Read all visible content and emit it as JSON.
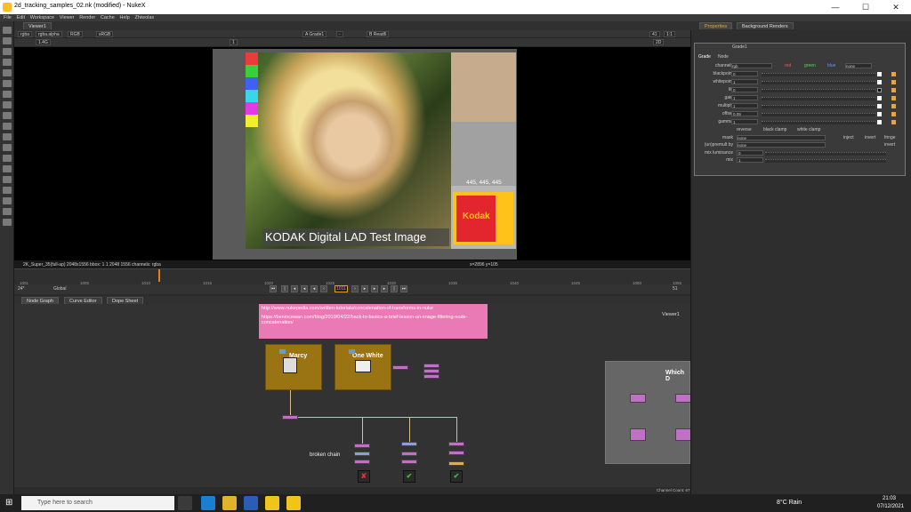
{
  "window": {
    "title": "2d_tracking_samples_02.nk (modified) - NukeX",
    "minimize": "—",
    "maximize": "☐",
    "close": "✕"
  },
  "menu": [
    "File",
    "Edit",
    "Workspace",
    "Viewer",
    "Render",
    "Cache",
    "Help",
    "Zhiwolas"
  ],
  "viewer": {
    "tab": "Viewer1",
    "controls1": [
      "rgba",
      "rgba.alpha",
      "RGB",
      "sRGB",
      "A  Grade1",
      "-",
      "B  Read6",
      "41",
      "1:1",
      "2D"
    ],
    "controls2": [
      "1.4G",
      "f/8",
      "1",
      "Y",
      "1"
    ],
    "image_value": "445, 445, 445",
    "kodak_logo": "Kodak",
    "caption": "KODAK Digital LAD Test Image",
    "info_left": "2K_Super_35(full-ap) 2048x1556  bbox: 1 1 2048 1556 channels: rgba",
    "info_right": "x=2896 y=105"
  },
  "timeline": {
    "ticks": [
      "1001",
      "1005",
      "1010",
      "1015",
      "1020",
      "1025",
      "1030",
      "1035",
      "1040",
      "1045",
      "1050",
      "1055"
    ],
    "fps": "24*",
    "mode": "Global",
    "frame": "1011",
    "end": "51"
  },
  "nodegraph": {
    "tabs": [
      "Node Graph",
      "Curve Editor",
      "Dope Sheet"
    ],
    "note_lines": [
      "http://www.nukepedia.com/written-tutorials/concatenation-of-transforms-in-nuke",
      "https://benmcewan.com/blog/2019/04/22/back-to-basics-a-brief-lesson-on-image-filtering-node-concatenation/"
    ],
    "backdrop1": "Marcy",
    "backdrop2": "One White",
    "backdrop3": "Which D",
    "viewer_label": "Viewer1",
    "broken_label": "broken chain",
    "viewer_nodes": [
      "✘",
      "✔",
      "✔"
    ],
    "status": "Channel Count: 67  Localization Mode: On  Memory: 6.8 GB (42.7%)  CPU: 0.0%  Disk: 0.0 MB/s  Network: 0.0 MB/s"
  },
  "properties": {
    "tabs": [
      "Properties",
      "Background Renders"
    ],
    "node_name": "Grade1",
    "subtabs": [
      "Grade",
      "Node"
    ],
    "channels_label": "channels",
    "channels_value": "rgb",
    "channel_toggles": [
      "red",
      "green",
      "blue",
      "none"
    ],
    "rows": [
      {
        "label": "blackpoint",
        "value": "0"
      },
      {
        "label": "whitepoint",
        "value": "1"
      },
      {
        "label": "lift",
        "value": "0"
      },
      {
        "label": "gain",
        "value": "1"
      },
      {
        "label": "multiply",
        "value": "1"
      },
      {
        "label": "offset",
        "value": "0.09"
      },
      {
        "label": "gamma",
        "value": "1"
      }
    ],
    "checks": [
      "reverse",
      "black clamp",
      "white clamp"
    ],
    "mask_label": "mask",
    "mask_value": "none",
    "mask_opts": [
      "inject",
      "invert",
      "fringe"
    ],
    "unpremult_label": "(un)premult by",
    "unpremult_value": "none",
    "invert": "invert",
    "mix_lum_label": "mix luminance",
    "mix_lum_value": "0",
    "mix_label": "mix",
    "mix_value": "1"
  },
  "taskbar": {
    "search_placeholder": "Type here to search",
    "weather": "8°C  Rain",
    "time": "21:03",
    "date": "07/12/2021"
  },
  "colors": {
    "accent_orange": "#e87e1a",
    "backdrop_gold": "#9a7412",
    "note_pink": "#ea7ab6",
    "node_pink": "#c071c6"
  }
}
